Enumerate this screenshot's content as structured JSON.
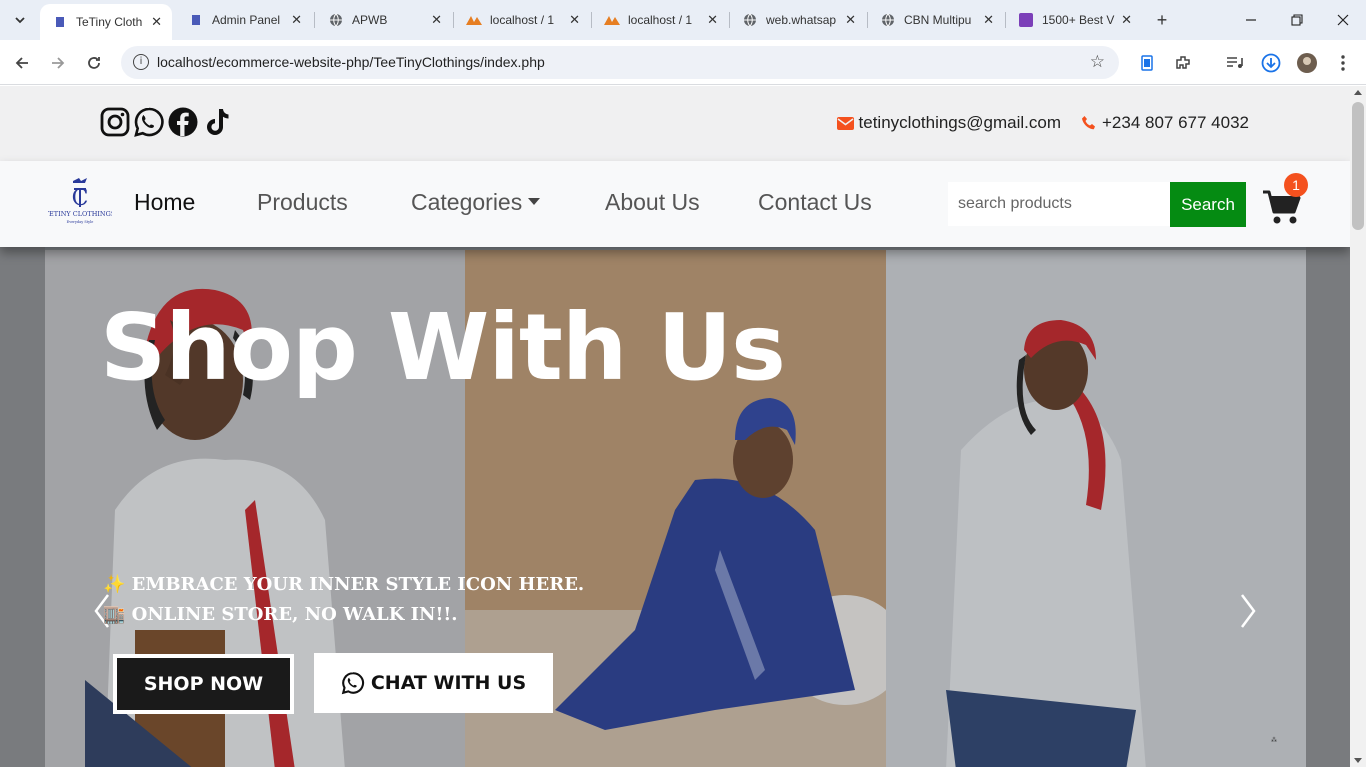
{
  "browser": {
    "tabs": [
      {
        "title": "TeTiny Cloth",
        "active": true,
        "icon": "site-logo-icon"
      },
      {
        "title": "Admin Panel",
        "active": false,
        "icon": "site-logo-icon"
      },
      {
        "title": "APWB",
        "active": false,
        "icon": "globe-icon"
      },
      {
        "title": "localhost / 1",
        "active": false,
        "icon": "phpmyadmin-icon"
      },
      {
        "title": "localhost / 1",
        "active": false,
        "icon": "phpmyadmin-icon"
      },
      {
        "title": "web.whatsap",
        "active": false,
        "icon": "globe-icon"
      },
      {
        "title": "CBN Multipu",
        "active": false,
        "icon": "globe-icon"
      },
      {
        "title": "1500+ Best V",
        "active": false,
        "icon": "colorlib-icon"
      }
    ],
    "url": "localhost/ecommerce-website-php/TeeTinyClothings/index.php"
  },
  "topbar": {
    "email": "tetinyclothings@gmail.com",
    "phone": "+234 807 677 4032",
    "accent": "#f4511e"
  },
  "navbar": {
    "links": [
      "Home",
      "Products",
      "Categories",
      "About Us",
      "Contact Us"
    ],
    "search_placeholder": "search products",
    "search_button": "Search",
    "cart_count": "1",
    "search_color": "#058b12"
  },
  "hero": {
    "title": "Shop With Us",
    "tagline_1": "✨ EMBRACE YOUR INNER STYLE ICON HERE.",
    "tagline_2": "🏬 ONLINE STORE, NO WALK IN!!.",
    "shop_button": "SHOP NOW",
    "chat_button": "CHAT WITH US"
  }
}
